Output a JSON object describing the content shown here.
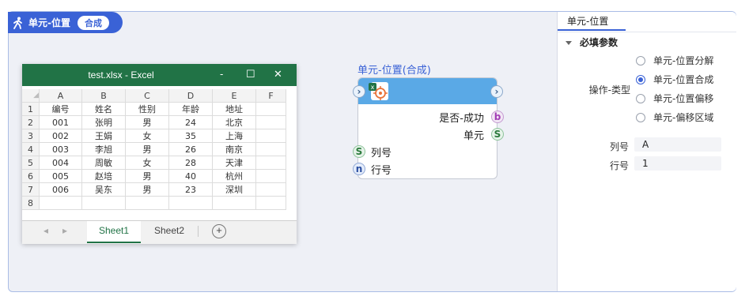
{
  "header": {
    "title": "单元-位置",
    "mode": "合成"
  },
  "excel": {
    "title": "test.xlsx  -  Excel",
    "controls": [
      "-",
      "☐",
      "✕"
    ],
    "columns": [
      "A",
      "B",
      "C",
      "D",
      "E",
      "F"
    ],
    "rows": [
      [
        "1",
        "编号",
        "姓名",
        "性别",
        "年龄",
        "地址",
        ""
      ],
      [
        "2",
        "001",
        "张明",
        "男",
        "24",
        "北京",
        ""
      ],
      [
        "3",
        "002",
        "王娟",
        "女",
        "35",
        "上海",
        ""
      ],
      [
        "4",
        "003",
        "李旭",
        "男",
        "26",
        "南京",
        ""
      ],
      [
        "5",
        "004",
        "周敏",
        "女",
        "28",
        "天津",
        ""
      ],
      [
        "6",
        "005",
        "赵培",
        "男",
        "40",
        "杭州",
        ""
      ],
      [
        "7",
        "006",
        "吴东",
        "男",
        "23",
        "深圳",
        ""
      ],
      [
        "8",
        "",
        "",
        "",
        "",
        "",
        ""
      ]
    ],
    "sheets": [
      "Sheet1",
      "Sheet2"
    ],
    "active_sheet": "Sheet1",
    "add_sheet": "+"
  },
  "node": {
    "title": "单元-位置(合成)",
    "outputs": [
      {
        "label": "是否-成功",
        "port": "b"
      },
      {
        "label": "单元",
        "port": "S"
      }
    ],
    "inputs": [
      {
        "label": "列号",
        "port": "S"
      },
      {
        "label": "行号",
        "port": "n"
      }
    ]
  },
  "panel": {
    "tab": "单元-位置",
    "section": "必填参数",
    "op_type_label": "操作-类型",
    "options": [
      {
        "label": "单元-位置分解",
        "selected": false
      },
      {
        "label": "单元-位置合成",
        "selected": true
      },
      {
        "label": "单元-位置偏移",
        "selected": false
      },
      {
        "label": "单元-偏移区域",
        "selected": false
      }
    ],
    "col_label": "列号",
    "col_value": "A",
    "row_label": "行号",
    "row_value": "1"
  },
  "colors": {
    "accent": "#3a62d6",
    "excel_green": "#217346",
    "node_head": "#5aa9e6"
  }
}
